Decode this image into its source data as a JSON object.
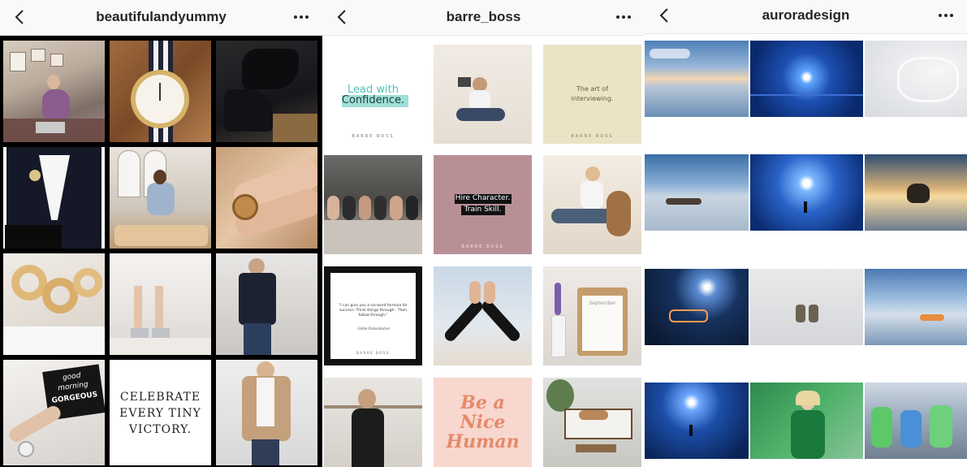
{
  "panels": [
    {
      "username": "beautifulandyummy",
      "back_icon": "chevron-left-icon",
      "more_icon": "more-horizontal-icon"
    },
    {
      "username": "barre_boss",
      "back_icon": "chevron-left-icon",
      "more_icon": "more-horizontal-icon"
    },
    {
      "username": "auroradesign",
      "back_icon": "chevron-left-icon",
      "more_icon": "more-horizontal-icon"
    }
  ],
  "posts": {
    "lead": {
      "line1": "Lead with",
      "line2": "Confidence.",
      "brand": "BARRE BOSS"
    },
    "art": {
      "line1": "The art of",
      "line2": "interviewing.",
      "brand": "BARRE BOSS"
    },
    "hire": {
      "line1": "Hire Character.",
      "line2": "Train Skill.",
      "brand": "BARRE BOSS"
    },
    "quote": {
      "text1": "\"I can give you a six-word formula for",
      "text2": "success: Think things through - Then",
      "text3": "follow through.\"",
      "author": "- Eddie Rickenbacker",
      "brand": "BARRE BOSS"
    },
    "celebrate": {
      "line1": "CELEBRATE",
      "line2": "EVERY TINY",
      "line3": "VICTORY."
    },
    "nice": {
      "line1": "Be a",
      "line2": "Nice",
      "line3": "Human"
    },
    "goodmorning": {
      "line1": "good",
      "line2": "morning",
      "line3": "GORGEOUS"
    },
    "calendar": {
      "label": "September"
    }
  },
  "colors": {
    "header_bg": "#f9f9f9",
    "title": "#262626",
    "grid_border": "#000000"
  }
}
